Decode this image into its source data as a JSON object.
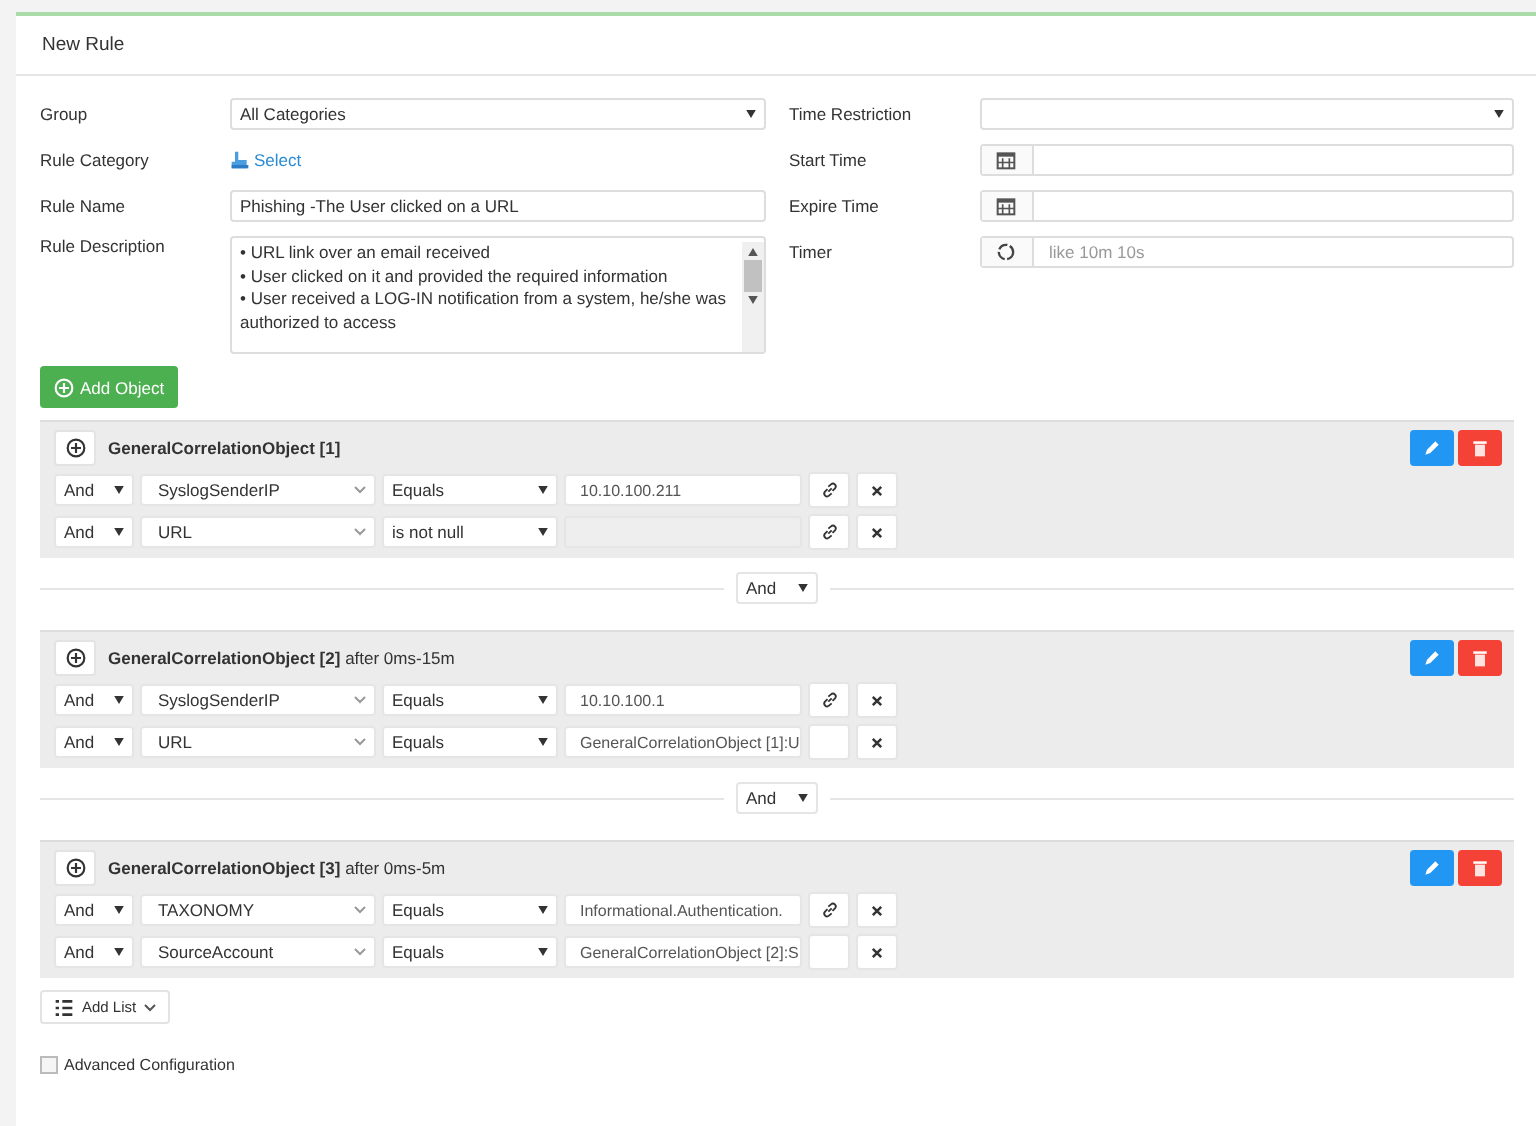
{
  "panel": {
    "title": "New Rule"
  },
  "form_left": [
    {
      "label": "Rule Category",
      "kind": "link",
      "value": "Select"
    },
    {
      "label": "Rule Name",
      "kind": "text",
      "value": "Phishing -The User clicked on a URL"
    }
  ],
  "group": {
    "label": "Group",
    "value": "All Categories"
  },
  "description": {
    "label": "Rule Description",
    "lines": [
      "•      URL link over an email received",
      "•      User clicked on it and provided the required information",
      "•      User received a LOG-IN notification from a system, he/she was authorized to access"
    ]
  },
  "form_right": [
    {
      "label": "Time Restriction",
      "kind": "select"
    },
    {
      "label": "Start Time",
      "kind": "date"
    },
    {
      "label": "Expire Time",
      "kind": "date"
    },
    {
      "label": "Timer",
      "kind": "timer",
      "placeholder": "like 10m 10s"
    }
  ],
  "add_object_button": "Add Object",
  "objects": [
    {
      "title": "**GeneralCorrelationObject [1]**",
      "conditions": [
        {
          "join": "And",
          "field": "SyslogSenderIP",
          "operator": "Equals",
          "value": "10.10.100.211",
          "disabled": false,
          "linked": true
        },
        {
          "join": "And",
          "field": "URL",
          "operator": "is not null",
          "disabled": true,
          "linked": true
        }
      ],
      "connector": "And"
    },
    {
      "title": "**GeneralCorrelationObject [2]** after 0ms-15m",
      "conditions": [
        {
          "join": "And",
          "field": "SyslogSenderIP",
          "operator": "Equals",
          "value": "10.10.100.1",
          "disabled": false,
          "linked": true
        },
        {
          "join": "And",
          "field": "URL",
          "operator": "Equals",
          "value": "GeneralCorrelationObject [1]:U",
          "disabled": false,
          "linked": false
        }
      ],
      "connector": "And"
    },
    {
      "title": "**GeneralCorrelationObject [3]** after 0ms-5m",
      "conditions": [
        {
          "join": "And",
          "field": "TAXONOMY",
          "operator": "Equals",
          "value": "Informational.Authentication.",
          "disabled": false,
          "linked": true
        },
        {
          "join": "And",
          "field": "SourceAccount",
          "operator": "Equals",
          "value": "GeneralCorrelationObject [2]:S",
          "disabled": false,
          "linked": false
        }
      ]
    }
  ],
  "add_list_button": "Add List",
  "advanced_configuration": {
    "label": "Advanced Configuration",
    "checked": false
  }
}
